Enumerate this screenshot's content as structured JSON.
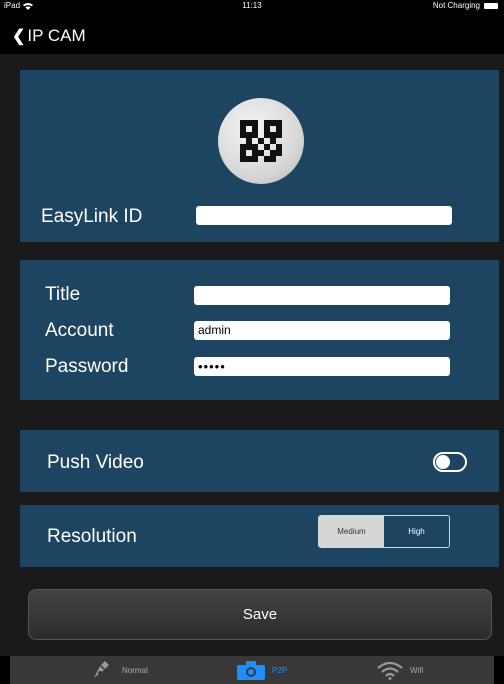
{
  "status": {
    "device": "iPad",
    "time": "11:13",
    "battery": "Not Charging"
  },
  "nav": {
    "back_label": "IP CAM"
  },
  "easylink": {
    "label": "EasyLink ID",
    "value": ""
  },
  "form": {
    "title_label": "Title",
    "title_value": "",
    "account_label": "Account",
    "account_value": "admin",
    "password_label": "Password",
    "password_value": "•••••"
  },
  "push": {
    "label": "Push Video",
    "enabled": false
  },
  "resolution": {
    "label": "Resolution",
    "options": [
      "Medium",
      "High"
    ],
    "selected": "Medium"
  },
  "save_label": "Save",
  "tabs": [
    {
      "label": "Normal",
      "icon": "camera-pen-icon"
    },
    {
      "label": "P2P",
      "icon": "camera-icon",
      "active": true
    },
    {
      "label": "Wifi",
      "icon": "wifi-icon"
    }
  ],
  "colors": {
    "card": "#1d4460",
    "accent": "#1e8fff"
  }
}
